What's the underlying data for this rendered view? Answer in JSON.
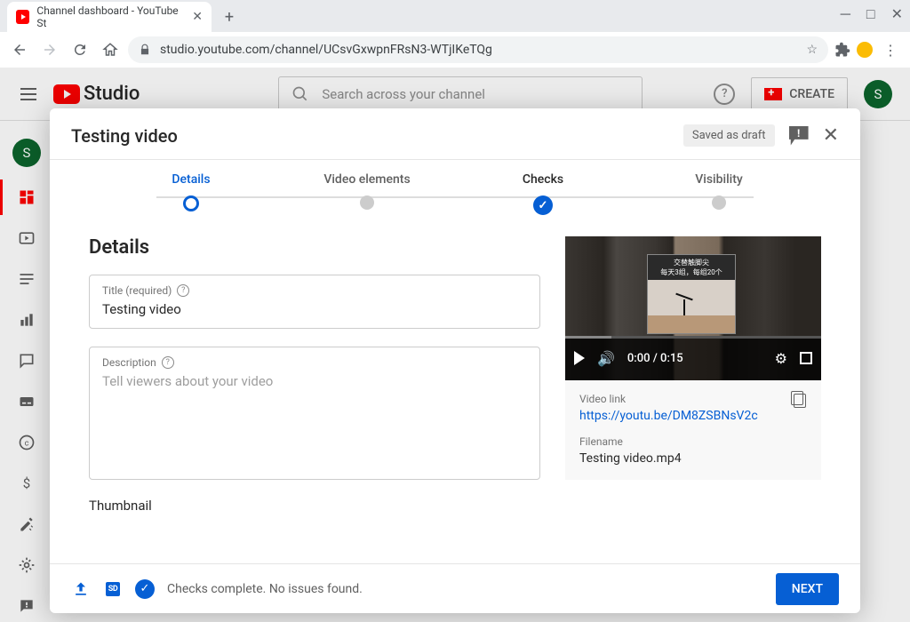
{
  "browser": {
    "tab_title": "Channel dashboard - YouTube St",
    "url": "studio.youtube.com/channel/UCsvGxwpnFRsN3-WTjIKeTQg"
  },
  "studio_header": {
    "logo_text": "Studio",
    "search_placeholder": "Search across your channel",
    "create_label": "CREATE",
    "avatar_initial": "S"
  },
  "left_rail": {
    "avatar_initial": "S"
  },
  "modal": {
    "title": "Testing video",
    "draft_badge": "Saved as draft",
    "steps": [
      {
        "label": "Details",
        "state": "active"
      },
      {
        "label": "Video elements",
        "state": "pending"
      },
      {
        "label": "Checks",
        "state": "done"
      },
      {
        "label": "Visibility",
        "state": "pending"
      }
    ],
    "section_title": "Details",
    "title_field": {
      "label": "Title (required)",
      "value": "Testing video"
    },
    "desc_field": {
      "label": "Description",
      "placeholder": "Tell viewers about your video"
    },
    "thumbnail_label": "Thumbnail",
    "preview": {
      "cjk_line1": "交替触脚尖",
      "cjk_line2": "每天3组，每组20个",
      "time": "0:00 / 0:15"
    },
    "meta": {
      "link_label": "Video link",
      "link_value": "https://youtu.be/DM8ZSBNsV2c",
      "filename_label": "Filename",
      "filename_value": "Testing video.mp4"
    },
    "footer_status": "Checks complete. No issues found.",
    "next_label": "NEXT",
    "hd_label": "SD"
  }
}
